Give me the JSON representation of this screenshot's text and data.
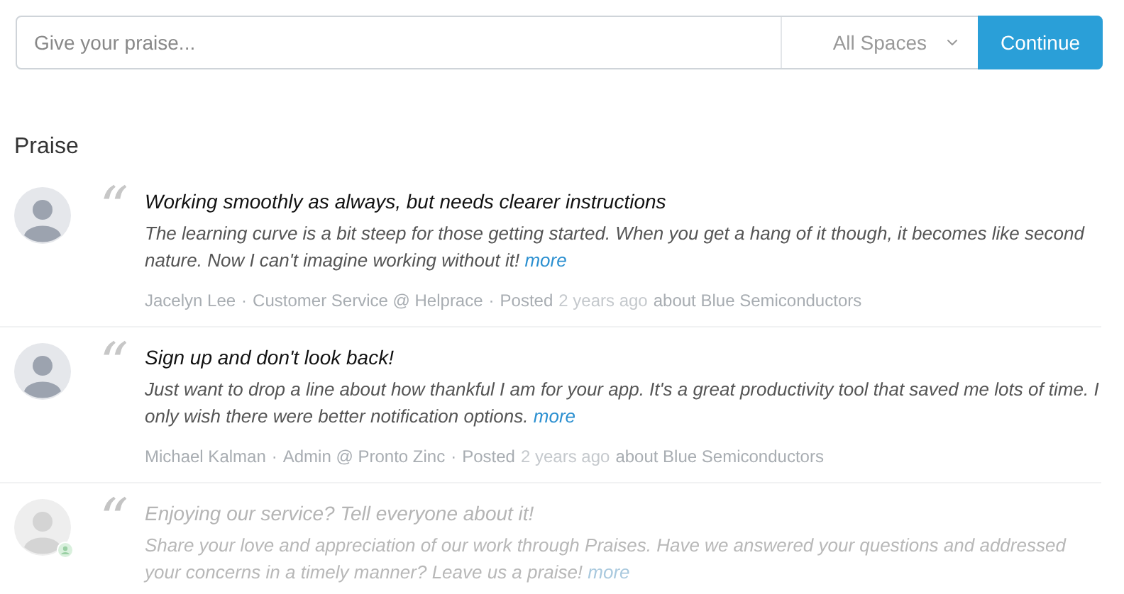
{
  "composer": {
    "placeholder": "Give your praise...",
    "space_select": "All Spaces",
    "button": "Continue"
  },
  "section_title": "Praise",
  "praises": [
    {
      "faded": false,
      "badge": false,
      "quote_mark": "“",
      "title": "Working smoothly as always, but needs clearer instructions",
      "body": "The learning curve is a bit steep for those getting started. When you get a hang of it though, it becomes like second nature. Now I can't imagine working without it!",
      "more": "more",
      "author": "Jacelyn Lee",
      "separator_1": "·",
      "role": "Customer Service @ Helprace",
      "separator_2": "·",
      "posted": "Posted",
      "time": "2 years ago",
      "about": "about Blue Semiconductors"
    },
    {
      "faded": false,
      "badge": false,
      "quote_mark": "“",
      "title": "Sign up and don't look back!",
      "body": "Just want to drop a line about how thankful I am for your app. It's a great productivity tool that saved me lots of time. I only wish there were better notification options.",
      "more": "more",
      "author": "Michael Kalman",
      "separator_1": "·",
      "role": "Admin @ Pronto Zinc",
      "separator_2": "·",
      "posted": "Posted",
      "time": "2 years ago",
      "about": "about Blue Semiconductors"
    },
    {
      "faded": true,
      "badge": true,
      "quote_mark": "“",
      "title": "Enjoying our service? Tell everyone about it!",
      "body": "Share your love and appreciation of our work through Praises. Have we answered your questions and addressed your concerns in a timely manner? Leave us a praise!",
      "more": "more"
    }
  ]
}
